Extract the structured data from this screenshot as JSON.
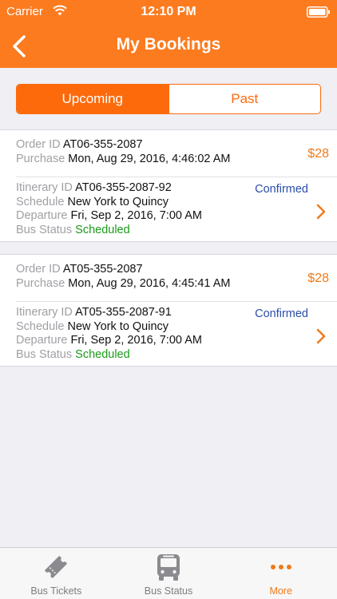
{
  "status_bar": {
    "carrier": "Carrier",
    "time": "12:10 PM"
  },
  "nav": {
    "title": "My Bookings",
    "back_icon": "chevron-left-icon"
  },
  "segments": {
    "upcoming": "Upcoming",
    "past": "Past",
    "selected": "Upcoming"
  },
  "labels": {
    "order_id": "Order ID",
    "purchase": "Purchase",
    "itinerary_id": "Itinerary ID",
    "schedule": "Schedule",
    "departure": "Departure",
    "bus_status": "Bus Status"
  },
  "bookings": [
    {
      "order_id": "AT06-355-2087",
      "purchase": "Mon, Aug 29, 2016, 4:46:02 AM",
      "price": "$28",
      "itinerary_id": "AT06-355-2087-92",
      "status": "Confirmed",
      "schedule": "New York to Quincy",
      "departure": "Fri, Sep 2, 2016, 7:00 AM",
      "bus_status": "Scheduled"
    },
    {
      "order_id": "AT05-355-2087",
      "purchase": "Mon, Aug 29, 2016, 4:45:41 AM",
      "price": "$28",
      "itinerary_id": "AT05-355-2087-91",
      "status": "Confirmed",
      "schedule": "New York to Quincy",
      "departure": "Fri, Sep 2, 2016, 7:00 AM",
      "bus_status": "Scheduled"
    }
  ],
  "tabs": [
    {
      "label": "Bus Tickets",
      "icon": "ticket-icon"
    },
    {
      "label": "Bus Status",
      "icon": "bus-icon"
    },
    {
      "label": "More",
      "icon": "more-dots-icon",
      "active": true
    }
  ],
  "colors": {
    "brand": "#fc7b1f",
    "price": "#f07a1b",
    "confirmed": "#2b4ea8",
    "scheduled": "#1a9a1a",
    "label": "#a0a0a5"
  }
}
